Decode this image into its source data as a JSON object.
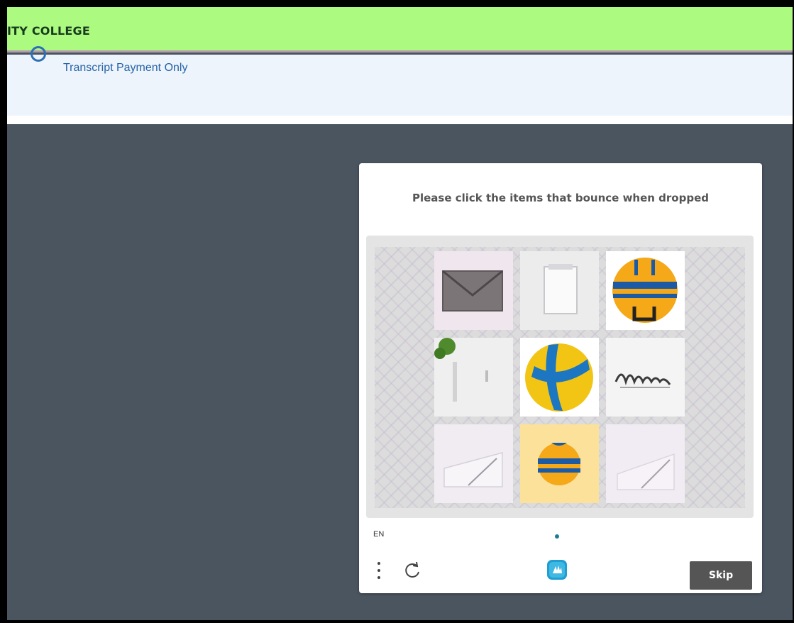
{
  "header": {
    "title": "ITY COLLEGE"
  },
  "subheader": {
    "label": "Transcript Payment Only"
  },
  "captcha": {
    "prompt": "Please click the items that bounce when dropped",
    "language": "EN",
    "skip_label": "Skip",
    "tiles": [
      {
        "content": "envelope-image"
      },
      {
        "content": "notepad-image"
      },
      {
        "content": "ball-image"
      },
      {
        "content": "plant-stationery-image"
      },
      {
        "content": "volleyball-image"
      },
      {
        "content": "signature-image"
      },
      {
        "content": "envelope-open-image"
      },
      {
        "content": "small-ball-image"
      },
      {
        "content": "envelope-pattern-image"
      }
    ]
  },
  "colors": {
    "header_bg": "#adfa80",
    "overlay_bg": "#4b5560",
    "skip_bg": "#555555",
    "subheader_text": "#2664a8"
  }
}
